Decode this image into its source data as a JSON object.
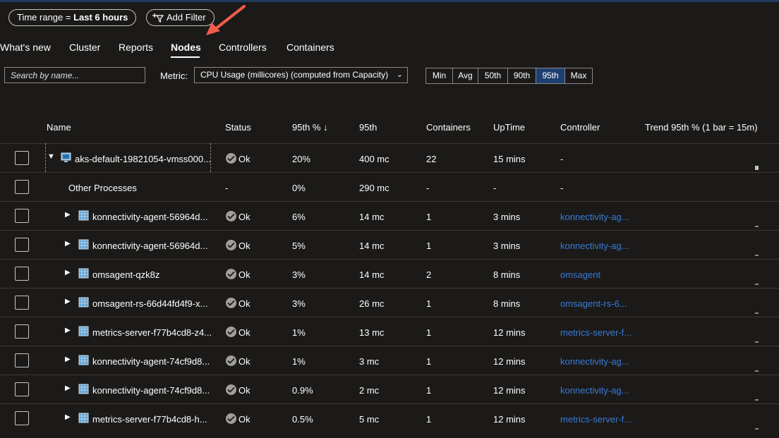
{
  "filters": {
    "time_range_prefix": "Time range = ",
    "time_range_value": "Last 6 hours",
    "add_filter": "Add Filter"
  },
  "tabs": [
    {
      "label": "What's new",
      "active": false
    },
    {
      "label": "Cluster",
      "active": false
    },
    {
      "label": "Reports",
      "active": false
    },
    {
      "label": "Nodes",
      "active": true
    },
    {
      "label": "Controllers",
      "active": false
    },
    {
      "label": "Containers",
      "active": false
    }
  ],
  "toolbar": {
    "search_placeholder": "Search by name...",
    "metric_label": "Metric:",
    "metric_value": "CPU Usage (millicores) (computed from Capacity)",
    "percentiles": [
      {
        "label": "Min",
        "selected": false
      },
      {
        "label": "Avg",
        "selected": false
      },
      {
        "label": "50th",
        "selected": false
      },
      {
        "label": "90th",
        "selected": false
      },
      {
        "label": "95th",
        "selected": true
      },
      {
        "label": "Max",
        "selected": false
      }
    ]
  },
  "table": {
    "columns": {
      "name": "Name",
      "status": "Status",
      "pct": "95th % ↓",
      "value": "95th",
      "containers": "Containers",
      "uptime": "UpTime",
      "controller": "Controller",
      "trend": "Trend 95th % (1 bar = 15m)"
    },
    "rows": [
      {
        "name": "aks-default-19821054-vmss000...",
        "status": "Ok",
        "pct": "20%",
        "value": "400 mc",
        "containers": "22",
        "uptime": "15 mins",
        "controller": "-",
        "level": 0,
        "expanded": true,
        "icon": "node-icon"
      },
      {
        "name": "Other Processes",
        "status": "-",
        "pct": "0%",
        "value": "290 mc",
        "containers": "-",
        "uptime": "-",
        "controller": "-",
        "level": 1,
        "expanded": null,
        "icon": ""
      },
      {
        "name": "konnectivity-agent-56964d...",
        "status": "Ok",
        "pct": "6%",
        "value": "14 mc",
        "containers": "1",
        "uptime": "3 mins",
        "controller": "konnectivity-ag...",
        "level": 1,
        "expanded": false,
        "icon": "pod-icon"
      },
      {
        "name": "konnectivity-agent-56964d...",
        "status": "Ok",
        "pct": "5%",
        "value": "14 mc",
        "containers": "1",
        "uptime": "3 mins",
        "controller": "konnectivity-ag...",
        "level": 1,
        "expanded": false,
        "icon": "pod-icon"
      },
      {
        "name": "omsagent-qzk8z",
        "status": "Ok",
        "pct": "3%",
        "value": "14 mc",
        "containers": "2",
        "uptime": "8 mins",
        "controller": "omsagent",
        "level": 1,
        "expanded": false,
        "icon": "pod-icon"
      },
      {
        "name": "omsagent-rs-66d44fd4f9-x...",
        "status": "Ok",
        "pct": "3%",
        "value": "26 mc",
        "containers": "1",
        "uptime": "8 mins",
        "controller": "omsagent-rs-6...",
        "level": 1,
        "expanded": false,
        "icon": "pod-icon"
      },
      {
        "name": "metrics-server-f77b4cd8-z4...",
        "status": "Ok",
        "pct": "1%",
        "value": "13 mc",
        "containers": "1",
        "uptime": "12 mins",
        "controller": "metrics-server-f...",
        "level": 1,
        "expanded": false,
        "icon": "pod-icon"
      },
      {
        "name": "konnectivity-agent-74cf9d8...",
        "status": "Ok",
        "pct": "1%",
        "value": "3 mc",
        "containers": "1",
        "uptime": "12 mins",
        "controller": "konnectivity-ag...",
        "level": 1,
        "expanded": false,
        "icon": "pod-icon"
      },
      {
        "name": "konnectivity-agent-74cf9d8...",
        "status": "Ok",
        "pct": "0.9%",
        "value": "2 mc",
        "containers": "1",
        "uptime": "12 mins",
        "controller": "konnectivity-ag...",
        "level": 1,
        "expanded": false,
        "icon": "pod-icon"
      },
      {
        "name": "metrics-server-f77b4cd8-h...",
        "status": "Ok",
        "pct": "0.5%",
        "value": "5 mc",
        "containers": "1",
        "uptime": "12 mins",
        "controller": "metrics-server-f...",
        "level": 1,
        "expanded": false,
        "icon": "pod-icon"
      }
    ]
  },
  "colors": {
    "background": "#1b1a19",
    "accent_selected": "#1e3f70",
    "link": "#3a7ad6",
    "annotation_arrow": "#f25c4a"
  }
}
